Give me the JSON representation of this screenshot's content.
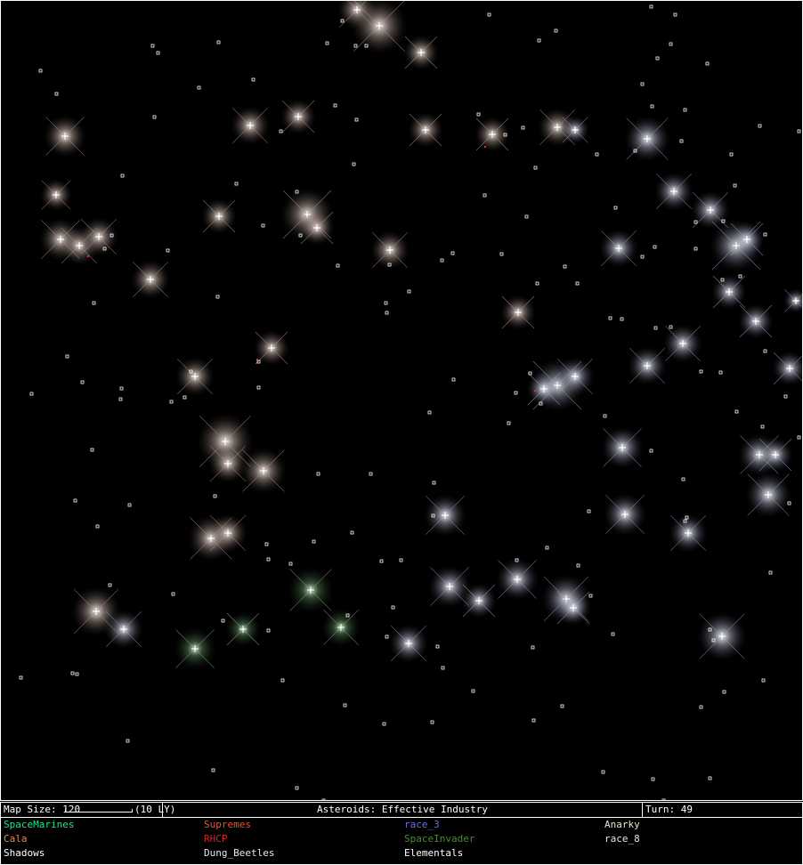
{
  "status_bar": {
    "map_size": "Map Size: 120",
    "scale_label": "(10 LY)",
    "info": "Asteroids: Effective Industry",
    "turn": "Turn: 49"
  },
  "legend": {
    "races": [
      {
        "name": "SpaceMarines",
        "color": "#22e08a"
      },
      {
        "name": "Supremes",
        "color": "#e5552e"
      },
      {
        "name": "race_3",
        "color": "#6a6ae8"
      },
      {
        "name": "Anarky",
        "color": "#e8e8c8"
      },
      {
        "name": "Cala",
        "color": "#e88a4a"
      },
      {
        "name": "RHCP",
        "color": "#c82a2a"
      },
      {
        "name": "SpaceInvader",
        "color": "#4a8a3a"
      },
      {
        "name": "race_8",
        "color": "#e8e8e8"
      },
      {
        "name": "Shadows",
        "color": "#ffffff"
      },
      {
        "name": "Dung_Beetles",
        "color": "#e8e8e8"
      },
      {
        "name": "Elementals",
        "color": "#ffffff"
      }
    ]
  },
  "map": {
    "star_groups": [
      {
        "owner": "Cala",
        "tint": "#ffe9dc"
      },
      {
        "owner": "race_8",
        "tint": "#e6e8ff"
      },
      {
        "owner": "SpaceInvader",
        "tint": "#d8ffd8"
      }
    ]
  }
}
